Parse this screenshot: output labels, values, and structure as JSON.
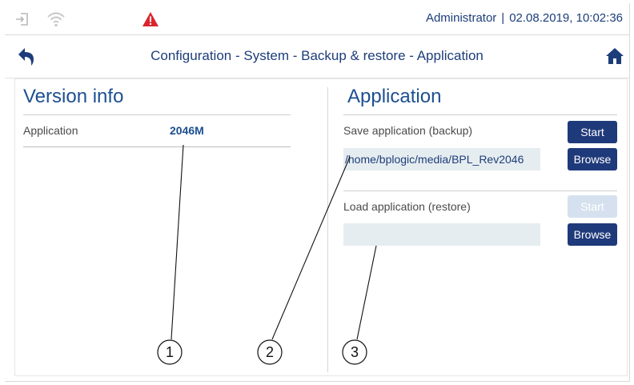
{
  "status_bar": {
    "user": "Administrator",
    "separator": "|",
    "datetime": "02.08.2019, 10:02:36",
    "icons": [
      "login-icon",
      "wifi-icon",
      "warning-icon"
    ],
    "warning_color": "#d9262c"
  },
  "nav": {
    "breadcrumb": "Configuration - System - Backup & restore - Application",
    "icons": [
      "back-icon",
      "home-icon"
    ]
  },
  "version_info": {
    "title": "Version info",
    "row_label": "Application",
    "row_value": "2046M"
  },
  "application": {
    "title": "Application",
    "save": {
      "label": "Save application (backup)",
      "path": "/home/bplogic/media/BPL_Rev2046",
      "start_label": "Start",
      "browse_label": "Browse"
    },
    "load": {
      "label": "Load application (restore)",
      "path": "",
      "start_label": "Start",
      "start_enabled": false,
      "browse_label": "Browse"
    }
  },
  "callouts": [
    "1",
    "2",
    "3"
  ],
  "colors": {
    "accent": "#1f3a7a",
    "title": "#1d4f91",
    "field_bg": "#e6edf0",
    "disabled_button": "#d6e1ef"
  }
}
